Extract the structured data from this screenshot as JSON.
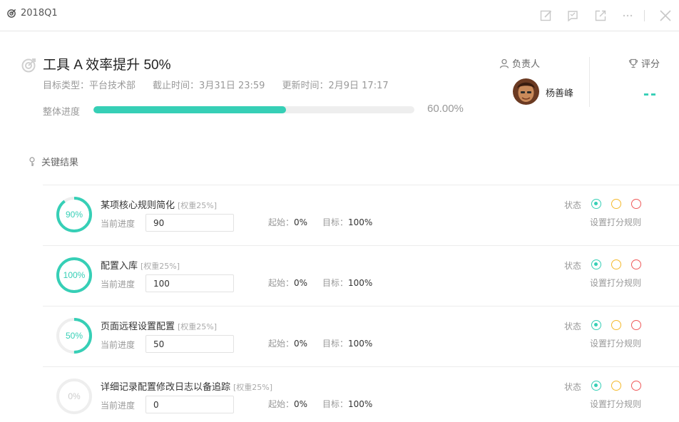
{
  "header": {
    "period": "2018Q1"
  },
  "objective": {
    "title": "工具 A 效率提升 50%",
    "type_label": "目标类型：",
    "type_value": "平台技术部",
    "deadline_label": "截止时间：",
    "deadline_value": "3月31日 23:59",
    "updated_label": "更新时间：",
    "updated_value": "2月9日 17:17",
    "progress_label": "整体进度",
    "progress_value": 0.6,
    "progress_text": "60.00%"
  },
  "owner": {
    "label": "负责人",
    "name": "杨善峰"
  },
  "score": {
    "label": "评分",
    "value": "--"
  },
  "key_results_header": "关键结果",
  "labels": {
    "current_progress": "当前进度",
    "start": "起始：",
    "target": "目标：",
    "status": "状态",
    "set_rule": "设置打分规则"
  },
  "key_results": [
    {
      "name": "某项核心规则简化",
      "weight": "[权重25%]",
      "ring_text": "90%",
      "progress": 0.9,
      "current": "90",
      "start": "0%",
      "target": "100%"
    },
    {
      "name": "配置入库",
      "weight": "[权重25%]",
      "ring_text": "100%",
      "progress": 1.0,
      "current": "100",
      "start": "0%",
      "target": "100%"
    },
    {
      "name": "页面远程设置配置",
      "weight": "[权重25%]",
      "ring_text": "50%",
      "progress": 0.5,
      "current": "50",
      "start": "0%",
      "target": "100%"
    },
    {
      "name": "详细记录配置修改日志以备追踪",
      "weight": "[权重25%]",
      "ring_text": "0%",
      "progress": 0.0,
      "current": "0",
      "start": "0%",
      "target": "100%"
    }
  ],
  "colors": {
    "accent": "#36cfb6",
    "status_yellow": "#f5b92b",
    "status_red": "#ef5a5a"
  }
}
